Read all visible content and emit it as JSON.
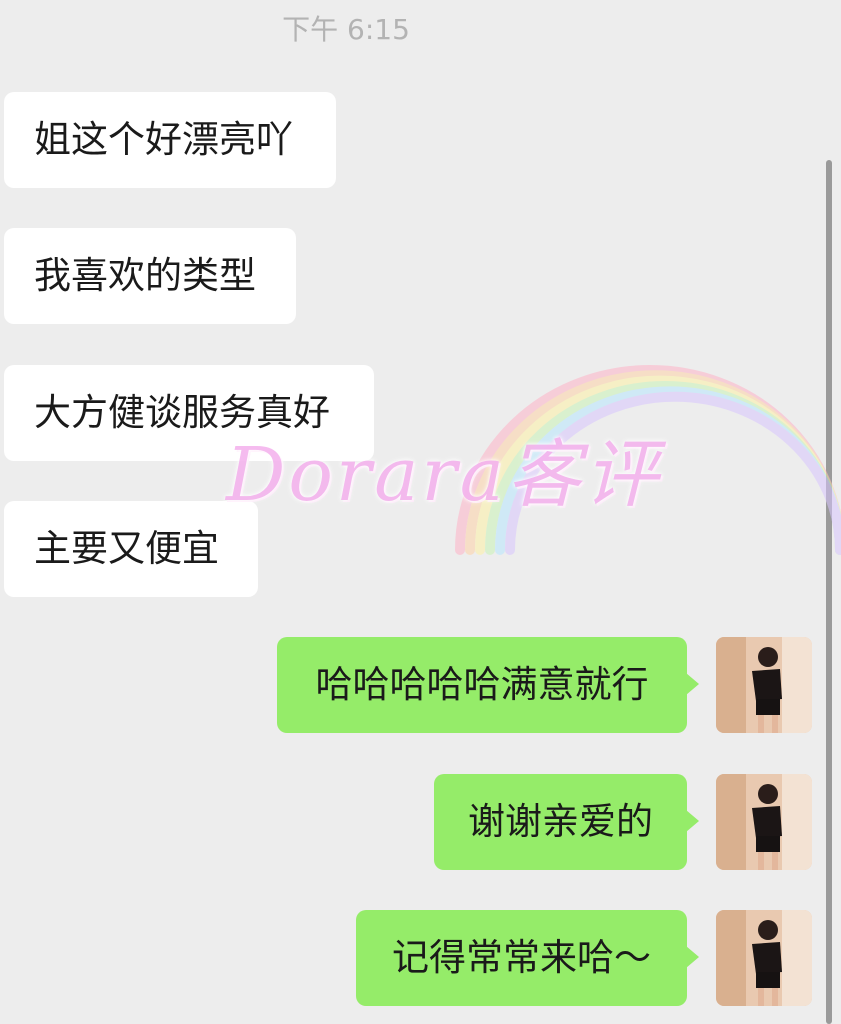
{
  "chat": {
    "timestamp": "下午 6:15",
    "incoming": [
      "姐这个好漂亮吖",
      "我喜欢的类型",
      "大方健谈服务真好",
      "主要又便宜"
    ],
    "outgoing": [
      "哈哈哈哈哈满意就行",
      "谢谢亲爱的",
      "记得常常来哈～"
    ]
  },
  "watermark": {
    "text": "Dorara客评"
  },
  "colors": {
    "background": "#ededed",
    "incoming_bubble": "#ffffff",
    "outgoing_bubble": "#95ec69",
    "timestamp_text": "#b3b3b3",
    "watermark_text": "#f4b4ee"
  },
  "icons": {
    "avatar": "user-avatar-photo",
    "watermark": "rainbow-watermark"
  }
}
